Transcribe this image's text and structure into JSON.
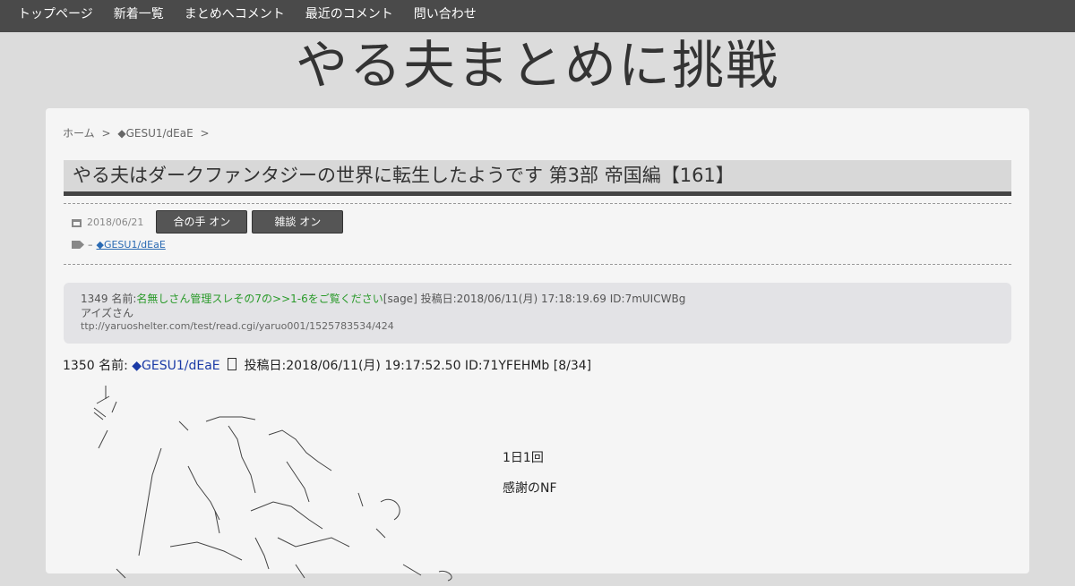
{
  "nav": {
    "items": [
      {
        "label": "トップページ"
      },
      {
        "label": "新着一覧"
      },
      {
        "label": "まとめへコメント"
      },
      {
        "label": "最近のコメント"
      },
      {
        "label": "問い合わせ"
      }
    ]
  },
  "site": {
    "title": "やる夫まとめに挑戦"
  },
  "breadcrumb": {
    "home": "ホーム",
    "sep1": ">",
    "author": "◆GESU1/dEaE",
    "sep2": ">"
  },
  "post": {
    "title": "やる夫はダークファンタジーの世界に転生したようです 第3部 帝国編【161】",
    "date": "2018/06/21",
    "toggle_aite": "合の手 オン",
    "toggle_zatsudan": "雑談 オン",
    "tag_prefix": "–",
    "tag": "◆GESU1/dEaE"
  },
  "quote": {
    "num": "1349",
    "name_label": "名前:",
    "name": "名無しさん管理スレその7の>>1-6をご覧ください",
    "sage": "[sage]",
    "posted": "投稿日:2018/06/11(月) 17:18:19.69 ID:7mUICWBg",
    "body": "アイズさん",
    "url": "ttp://yaruoshelter.com/test/read.cgi/yaruo001/1525783534/424"
  },
  "res": {
    "num": "1350",
    "name_label": "名前:",
    "name": "◆GESU1/dEaE",
    "posted": "投稿日:2018/06/11(月) 19:17:52.50 ID:71YFEHMb [8/34]"
  },
  "body_lines": {
    "line1": "1日1回",
    "line2": "感謝のNF"
  },
  "colors": {
    "nav_bg": "#4a4a4a",
    "page_bg": "#dcdcdc",
    "card_bg": "#f5f5f5",
    "link": "#2a6ab3",
    "quote_name": "#2a9a2a",
    "res_name": "#1a3aa6"
  }
}
